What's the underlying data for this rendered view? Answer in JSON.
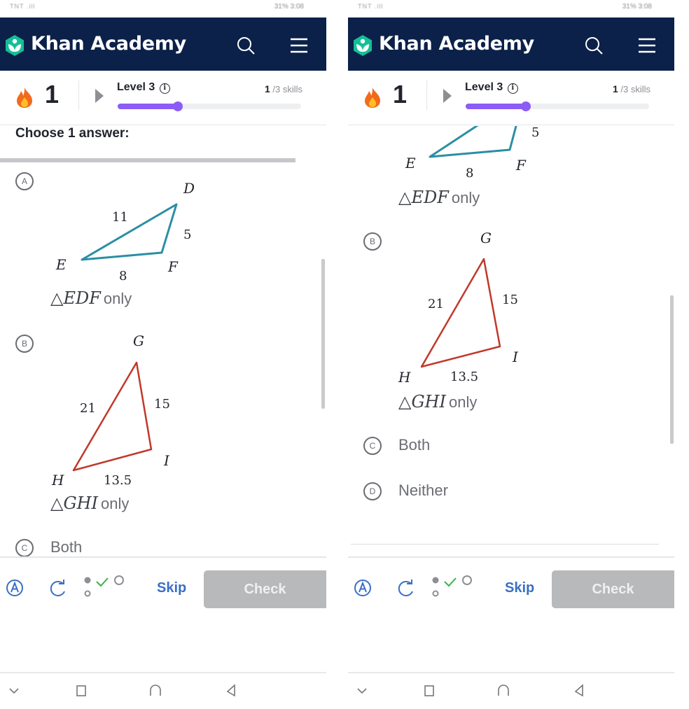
{
  "screens": [
    {
      "status": {
        "left": "TNT .ill",
        "right": "31% 3:08"
      },
      "nav": {
        "brand": "Khan Academy",
        "logo_icon": "khan-academy-logo",
        "search_icon": "search-icon",
        "menu_icon": "hamburger-menu-icon"
      },
      "progress": {
        "streak": "1",
        "level": "Level 3",
        "skills_done": "1",
        "skills_total": " /3 skills",
        "level_fraction": 0.33
      },
      "question": {
        "prompt": "Choose 1 answer:"
      },
      "choices": [
        {
          "letter": "A",
          "label_math": "△EDF",
          "label_suffix": "only",
          "triangle": {
            "color": "#2a8fa3",
            "vertices": [
              "E",
              "D",
              "F"
            ],
            "sides": [
              "11",
              "5",
              "8"
            ]
          }
        },
        {
          "letter": "B",
          "label_math": "△GHI",
          "label_suffix": "only",
          "triangle": {
            "color": "#c0392b",
            "vertices": [
              "G",
              "H",
              "I"
            ],
            "sides": [
              "21",
              "15",
              "13.5"
            ]
          }
        },
        {
          "letter": "C",
          "text": "Both"
        },
        {
          "letter": "D",
          "text": "Neither"
        }
      ],
      "footer": {
        "skip": "Skip",
        "check": "Check"
      }
    }
  ]
}
